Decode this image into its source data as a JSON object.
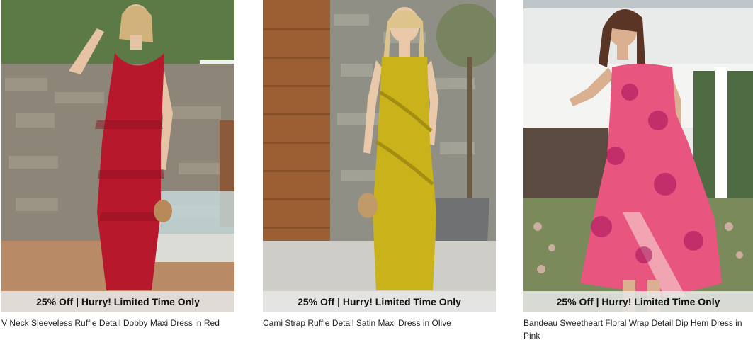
{
  "products": [
    {
      "promo": "25% Off | Hurry! Limited Time Only",
      "title": "V Neck Sleeveless Ruffle Detail Dobby Maxi Dress in Red",
      "dress_color": "#b8182c"
    },
    {
      "promo": "25% Off | Hurry! Limited Time Only",
      "title": "Cami Strap Ruffle Detail Satin Maxi Dress in Olive",
      "dress_color": "#c9b21a"
    },
    {
      "promo": "25% Off | Hurry! Limited Time Only",
      "title": "Bandeau Sweetheart Floral Wrap Detail Dip Hem Dress in Pink",
      "dress_color": "#e8557f"
    }
  ]
}
